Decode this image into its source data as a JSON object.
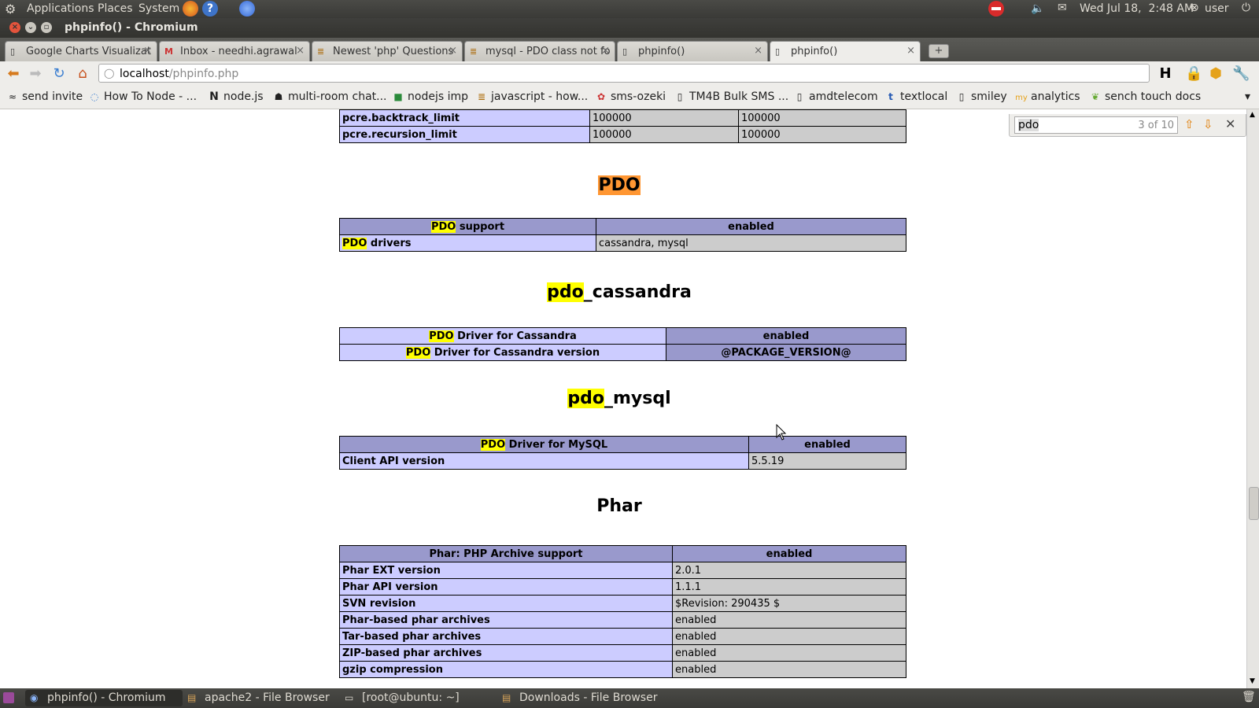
{
  "top_panel": {
    "menus": [
      "Applications",
      "Places",
      "System"
    ],
    "clock": "Wed Jul 18,  2:48 AM",
    "user": "user"
  },
  "window": {
    "title": "phpinfo() - Chromium"
  },
  "tabs": [
    {
      "label": "Google Charts Visualizat"
    },
    {
      "label": "Inbox - needhi.agrawal"
    },
    {
      "label": "Newest 'php' Questions"
    },
    {
      "label": "mysql - PDO class not fo"
    },
    {
      "label": "phpinfo()"
    },
    {
      "label": "phpinfo()"
    }
  ],
  "omnibox": {
    "host": "localhost",
    "path": "/phpinfo.php"
  },
  "bookmarks": [
    "send invite",
    "How To Node - ...",
    "node.js",
    "multi-room chat...",
    "nodejs imp",
    "javascript - how...",
    "sms-ozeki",
    "TM4B Bulk SMS ...",
    "amdtelecom",
    "textlocal",
    "smiley",
    "analytics",
    "sench touch docs"
  ],
  "find": {
    "query": "pdo",
    "count": "3 of 10"
  },
  "page": {
    "pcre_rows": [
      {
        "name": "pcre.backtrack_limit",
        "local": "100000",
        "master": "100000"
      },
      {
        "name": "pcre.recursion_limit",
        "local": "100000",
        "master": "100000"
      }
    ],
    "pdo": {
      "title": "PDO",
      "support_hl": "PDO",
      "support_rest": " support",
      "support_value": "enabled",
      "drivers_hl": "PDO",
      "drivers_rest": " drivers",
      "drivers_value": "cassandra, mysql"
    },
    "pdo_cassandra": {
      "title_hl": "pdo",
      "title_rest": "_cassandra",
      "r1_hl": "PDO",
      "r1_rest": " Driver for Cassandra",
      "r1_value": "enabled",
      "r2_hl": "PDO",
      "r2_rest": " Driver for Cassandra version",
      "r2_value": "@PACKAGE_VERSION@"
    },
    "pdo_mysql": {
      "title_hl": "pdo",
      "title_rest": "_mysql",
      "r1_hl": "PDO",
      "r1_rest": " Driver for MySQL",
      "r1_value": "enabled",
      "r2_name": "Client API version",
      "r2_value": "5.5.19"
    },
    "phar": {
      "title": "Phar",
      "header_name": "Phar: PHP Archive support",
      "header_value": "enabled",
      "rows": [
        {
          "name": "Phar EXT version",
          "value": "2.0.1"
        },
        {
          "name": "Phar API version",
          "value": "1.1.1"
        },
        {
          "name": "SVN revision",
          "value": "$Revision: 290435 $"
        },
        {
          "name": "Phar-based phar archives",
          "value": "enabled"
        },
        {
          "name": "Tar-based phar archives",
          "value": "enabled"
        },
        {
          "name": "ZIP-based phar archives",
          "value": "enabled"
        },
        {
          "name": "gzip compression",
          "value": "enabled"
        }
      ]
    }
  },
  "taskbar": [
    {
      "label": "phpinfo() - Chromium"
    },
    {
      "label": "apache2 - File Browser"
    },
    {
      "label": "[root@ubuntu: ~]"
    },
    {
      "label": "Downloads - File Browser"
    }
  ]
}
